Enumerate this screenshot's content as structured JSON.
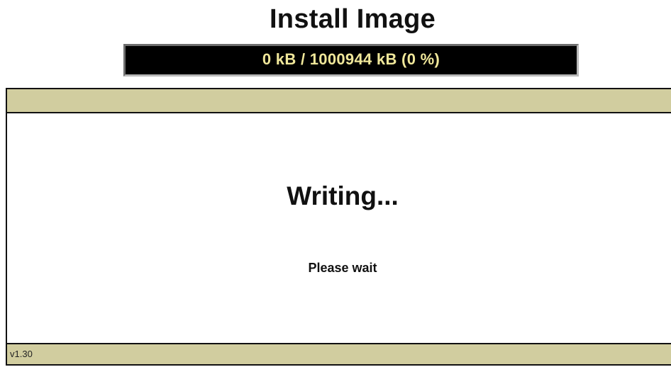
{
  "header": {
    "title": "Install Image"
  },
  "progress": {
    "text": "0 kB / 1000944 kB (0 %)",
    "fraction": 0
  },
  "panel": {
    "heading": "Writing...",
    "subtext": "Please wait"
  },
  "footer": {
    "version": "v1.30"
  },
  "colors": {
    "band": "#d1cd9f",
    "progress_text": "#f0e79a",
    "progress_background": "#000000"
  }
}
